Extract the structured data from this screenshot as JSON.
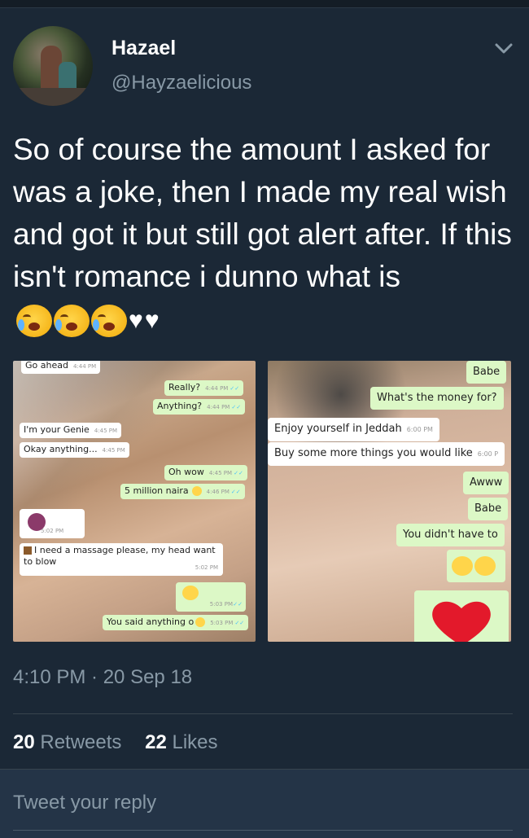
{
  "author": {
    "name": "Hazael",
    "handle": "@Hayzaelicious"
  },
  "tweet": {
    "text": "So of course the amount I asked for was a joke, then I made my real wish and got it but still got alert after. If this isn't romance i dunno what is",
    "emojis": [
      "loudly-crying-face-icon",
      "loudly-crying-face-icon",
      "loudly-crying-face-icon",
      "white-heart-icon",
      "white-heart-icon"
    ],
    "timestamp": "4:10 PM · 20 Sep 18"
  },
  "chat_left": {
    "messages": [
      {
        "text": "Go ahead",
        "time": "4:44 PM",
        "dir": "in"
      },
      {
        "text": "Really?",
        "time": "4:44 PM",
        "dir": "out"
      },
      {
        "text": "Anything?",
        "time": "4:44 PM",
        "dir": "out"
      },
      {
        "text": "I'm your Genie",
        "time": "4:45 PM",
        "dir": "in"
      },
      {
        "text": "Okay anything...",
        "time": "4:45 PM",
        "dir": "in"
      },
      {
        "text": "Oh wow",
        "time": "4:45 PM",
        "dir": "out"
      },
      {
        "text": "5 million naira",
        "time": "4:46 PM",
        "dir": "out"
      },
      {
        "text": "",
        "time": "5:02 PM",
        "dir": "in"
      },
      {
        "text": "I need a massage please, my head want to blow",
        "time": "5:02 PM",
        "dir": "in"
      },
      {
        "text": "",
        "time": "5:03 PM",
        "dir": "out"
      },
      {
        "text": "You said anything o",
        "time": "5:03 PM",
        "dir": "out"
      }
    ]
  },
  "chat_right": {
    "messages": [
      {
        "text": "Babe",
        "dir": "out"
      },
      {
        "text": "What's the money for?",
        "dir": "out"
      },
      {
        "text": "Enjoy yourself in Jeddah",
        "time": "6:00 PM",
        "dir": "in"
      },
      {
        "text": "Buy some more things you would like",
        "time": "6:00 P",
        "dir": "in"
      },
      {
        "text": "Awww",
        "dir": "out"
      },
      {
        "text": "Babe",
        "dir": "out"
      },
      {
        "text": "You didn't have to",
        "dir": "out"
      }
    ]
  },
  "stats": {
    "retweets_count": "20",
    "retweets_label": "Retweets",
    "likes_count": "22",
    "likes_label": "Likes"
  },
  "reply": {
    "placeholder": "Tweet your reply"
  },
  "colors": {
    "background": "#1b2836",
    "secondary_text": "#8899a6",
    "outgoing_bubble": "#dcf8c6",
    "incoming_bubble": "#ffffff"
  }
}
